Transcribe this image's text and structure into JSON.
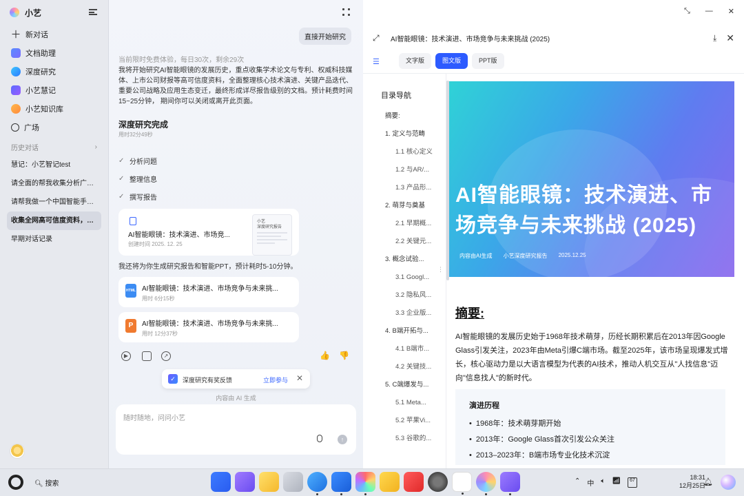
{
  "sidebar": {
    "app_name": "小艺",
    "nav": [
      {
        "label": "新对话",
        "icon": "plus-icon"
      },
      {
        "label": "文档助理",
        "icon": "document-assistant-icon"
      },
      {
        "label": "深度研究",
        "icon": "deep-research-icon"
      },
      {
        "label": "小艺慧记",
        "icon": "notes-icon"
      },
      {
        "label": "小艺知识库",
        "icon": "knowledge-base-icon"
      },
      {
        "label": "广场",
        "icon": "plaza-icon"
      }
    ],
    "history_label": "历史对话",
    "history": [
      "慧记：小艺智记test",
      "请全面的帮我收集分析广州...",
      "请帮我做一个中国智能手机...",
      "收集全网高可信度资料，详...",
      "早期对话记录"
    ]
  },
  "chat": {
    "direct_button": "直接开始研究",
    "free_notice": "当前限时免费体验，每日30次，剩余29次",
    "plan_text": "我将开始研究AI智能眼镜的发展历史，重点收集学术论文与专利、权威科技媒体、上市公司财报等高可信度资料，全面整理核心技术演进、关键产品迭代、重要公司战略及应用生态变迁，最终形成详尽报告级别的文档。预计耗费时间15~25分钟， 期间你可以关闭或离开此页面。",
    "done_title": "深度研究完成",
    "done_time": "用时32分49秒",
    "steps": [
      "分析问题",
      "整理信息",
      "撰写报告"
    ],
    "report_card": {
      "title": "AI智能眼镜：技术演进、市场竞...",
      "created": "创建时间 2025. 12. 25",
      "thumb_title": "小艺\n深度研究报告"
    },
    "also_text": "我还将为你生成研究报告和智能PPT，预计耗时5-10分钟。",
    "files": [
      {
        "type": "HTML",
        "title": "AI智能眼镜：技术演进、市场竞争与未来挑...",
        "time": "用时 6分15秒"
      },
      {
        "type": "P",
        "title": "AI智能眼镜：技术演进、市场竞争与未来挑...",
        "time": "用时 12分37秒"
      }
    ],
    "feedback": {
      "text": "深度研究有奖反馈",
      "link": "立即参与"
    },
    "ai_generated": "内容由 AI 生成",
    "input_placeholder": "随时随地，问问小艺"
  },
  "report": {
    "title": "AI智能眼镜：技术演进、市场竞争与未来挑战 (2025)",
    "tabs": [
      "文字版",
      "图文版",
      "PPT版"
    ],
    "active_tab": 1,
    "toc_title": "目录导航",
    "toc": [
      {
        "label": "摘要:",
        "level": 1
      },
      {
        "label": "1. 定义与范畴",
        "level": 1
      },
      {
        "label": "1.1 核心定义",
        "level": 2
      },
      {
        "label": "1.2 与AR/...",
        "level": 2
      },
      {
        "label": "1.3 产品形...",
        "level": 2
      },
      {
        "label": "2. 萌芽与奠基",
        "level": 1
      },
      {
        "label": "2.1 早期概...",
        "level": 2
      },
      {
        "label": "2.2 关键元...",
        "level": 2
      },
      {
        "label": "3. 概念试验...",
        "level": 1
      },
      {
        "label": "3.1 Googl...",
        "level": 2
      },
      {
        "label": "3.2 隐私风...",
        "level": 2
      },
      {
        "label": "3.3 企业版...",
        "level": 2
      },
      {
        "label": "4. B端开拓与...",
        "level": 1
      },
      {
        "label": "4.1 B端市...",
        "level": 2
      },
      {
        "label": "4.2 关键技...",
        "level": 2
      },
      {
        "label": "5. C端爆发与...",
        "level": 1
      },
      {
        "label": "5.1 Meta...",
        "level": 2
      },
      {
        "label": "5.2 苹果Vi...",
        "level": 2
      },
      {
        "label": "5.3 谷歌的...",
        "level": 2
      }
    ],
    "hero": {
      "title": "AI智能眼镜：技术演进、市场竞争与未来挑战 (2025)",
      "meta": [
        "内容由AI生成",
        "小艺深度研究报告",
        "2025.12.25"
      ]
    },
    "abstract_title": "摘要:",
    "abstract_text": "AI智能眼镜的发展历史始于1968年技术萌芽，历经长期积累后在2013年因Google Glass引发关注，2023年由Meta引爆C端市场。截至2025年，该市场呈现爆发式增长，核心驱动力是以大语言模型为代表的AI技术，推动人机交互从\"人找信息\"迈向\"信息找人\"的新时代。",
    "timeline_title": "演进历程",
    "timeline": [
      "1968年：技术萌芽期开始",
      "2013年：Google Glass首次引发公众关注",
      "2013–2023年：B端市场专业化技术沉淀"
    ]
  },
  "taskbar": {
    "search_label": "搜索",
    "apps": [
      "multitask",
      "gallery-folder",
      "notes",
      "trash",
      "browser",
      "mail",
      "photos",
      "files",
      "app-gallery",
      "settings",
      "wps",
      "xiaoyi",
      "assistant"
    ],
    "time": "18:31",
    "date": "12月25日",
    "battery": "67"
  }
}
